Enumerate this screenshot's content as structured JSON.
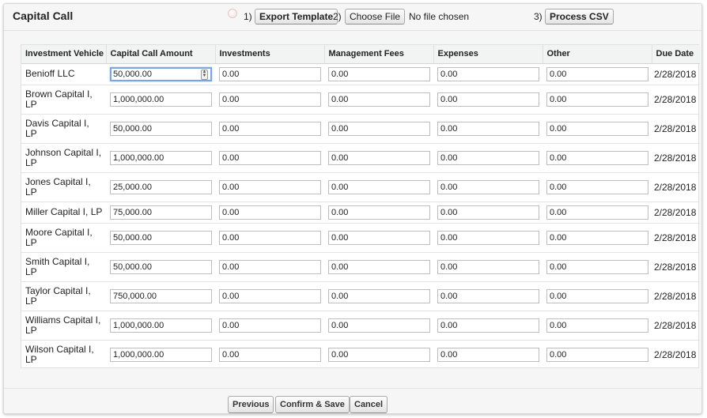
{
  "page": {
    "title": "Capital Call"
  },
  "toolbar": {
    "step1_label": "1)",
    "export_label": "Export Template",
    "step2_label": "2)",
    "choose_file_label": "Choose File",
    "no_file_text": "No file chosen",
    "step3_label": "3)",
    "process_label": "Process CSV"
  },
  "table": {
    "headers": [
      "Investment Vehicle",
      "Capital Call Amount",
      "Investments",
      "Management Fees",
      "Expenses",
      "Other",
      "Due Date"
    ],
    "rows": [
      {
        "vehicle": "Benioff LLC",
        "amount": "50,000.00",
        "investments": "0.00",
        "fees": "0.00",
        "expenses": "0.00",
        "other": "0.00",
        "due": "2/28/2018"
      },
      {
        "vehicle": "Brown Capital I, LP",
        "amount": "1,000,000.00",
        "investments": "0.00",
        "fees": "0.00",
        "expenses": "0.00",
        "other": "0.00",
        "due": "2/28/2018"
      },
      {
        "vehicle": "Davis Capital I, LP",
        "amount": "50,000.00",
        "investments": "0.00",
        "fees": "0.00",
        "expenses": "0.00",
        "other": "0.00",
        "due": "2/28/2018"
      },
      {
        "vehicle": "Johnson Capital I, LP",
        "amount": "1,000,000.00",
        "investments": "0.00",
        "fees": "0.00",
        "expenses": "0.00",
        "other": "0.00",
        "due": "2/28/2018"
      },
      {
        "vehicle": "Jones Capital I, LP",
        "amount": "25,000.00",
        "investments": "0.00",
        "fees": "0.00",
        "expenses": "0.00",
        "other": "0.00",
        "due": "2/28/2018"
      },
      {
        "vehicle": "Miller Capital I, LP",
        "amount": "75,000.00",
        "investments": "0.00",
        "fees": "0.00",
        "expenses": "0.00",
        "other": "0.00",
        "due": "2/28/2018"
      },
      {
        "vehicle": "Moore Capital I, LP",
        "amount": "50,000.00",
        "investments": "0.00",
        "fees": "0.00",
        "expenses": "0.00",
        "other": "0.00",
        "due": "2/28/2018"
      },
      {
        "vehicle": "Smith Capital I, LP",
        "amount": "50,000.00",
        "investments": "0.00",
        "fees": "0.00",
        "expenses": "0.00",
        "other": "0.00",
        "due": "2/28/2018"
      },
      {
        "vehicle": "Taylor Capital I, LP",
        "amount": "750,000.00",
        "investments": "0.00",
        "fees": "0.00",
        "expenses": "0.00",
        "other": "0.00",
        "due": "2/28/2018"
      },
      {
        "vehicle": "Williams Capital I, LP",
        "amount": "1,000,000.00",
        "investments": "0.00",
        "fees": "0.00",
        "expenses": "0.00",
        "other": "0.00",
        "due": "2/28/2018"
      },
      {
        "vehicle": "Wilson Capital I, LP",
        "amount": "1,000,000.00",
        "investments": "0.00",
        "fees": "0.00",
        "expenses": "0.00",
        "other": "0.00",
        "due": "2/28/2018"
      }
    ]
  },
  "footer": {
    "previous_label": "Previous",
    "confirm_label": "Confirm & Save",
    "cancel_label": "Cancel"
  },
  "icons": {
    "status_dot": "radio-dot-icon",
    "spinner": "spinner-icon"
  }
}
